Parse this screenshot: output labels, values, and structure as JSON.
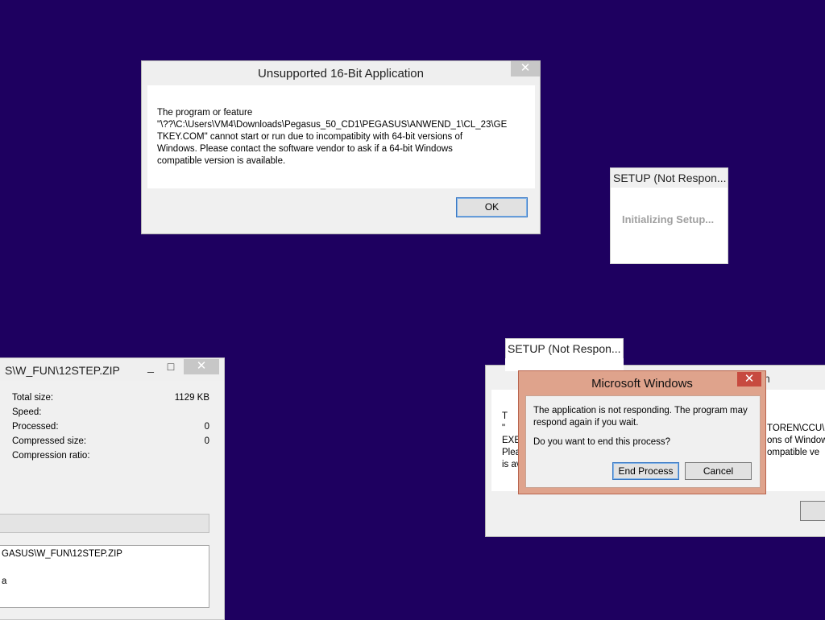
{
  "unsupported_dialog": {
    "title": "Unsupported 16-Bit Application",
    "message_lines": [
      "The program or feature",
      "\"\\??\\C:\\Users\\VM4\\Downloads\\Pegasus_50_CD1\\PEGASUS\\ANWEND_1\\CL_23\\GE",
      "TKEY.COM\" cannot start or run due to incompatibity with 64-bit versions of",
      "Windows. Please contact the software vendor to ask if a 64-bit Windows",
      "compatible version is available."
    ],
    "ok_label": "OK"
  },
  "setup_window_1": {
    "title": "SETUP (Not Respon...",
    "status": "Initializing Setup..."
  },
  "setup_window_2": {
    "title": "SETUP (Not Respon..."
  },
  "zip_window": {
    "title": "S\\W_FUN\\12STEP.ZIP",
    "rows": [
      {
        "label": "Total size:",
        "value": "1129 KB"
      },
      {
        "label": "Speed:",
        "value": ""
      },
      {
        "label": "Processed:",
        "value": "0"
      },
      {
        "label": "Compressed size:",
        "value": "0"
      },
      {
        "label": "Compression ratio:",
        "value": ""
      }
    ],
    "log_lines": [
      "GASUS\\W_FUN\\12STEP.ZIP",
      "",
      "a"
    ]
  },
  "behind_dialog": {
    "partial_title_char": "n",
    "partial_lines": [
      "T",
      "\"",
      "EXE",
      "Plea",
      "is av"
    ],
    "right_lines": [
      "TOREN\\CCU\\",
      "ons of Window",
      "ompatible ve"
    ]
  },
  "ms_dialog": {
    "title": "Microsoft Windows",
    "message_line1": "The application is not responding. The program may",
    "message_line2": "respond again if you wait.",
    "question": "Do you want to end this process?",
    "end_label": "End Process",
    "cancel_label": "Cancel"
  },
  "icons": {
    "close": "✕",
    "minimize": "_",
    "maximize": "□"
  },
  "colors": {
    "desktop": "#1e0060",
    "close_red": "#c74a3f",
    "ms_frame": "#dfa38c"
  }
}
